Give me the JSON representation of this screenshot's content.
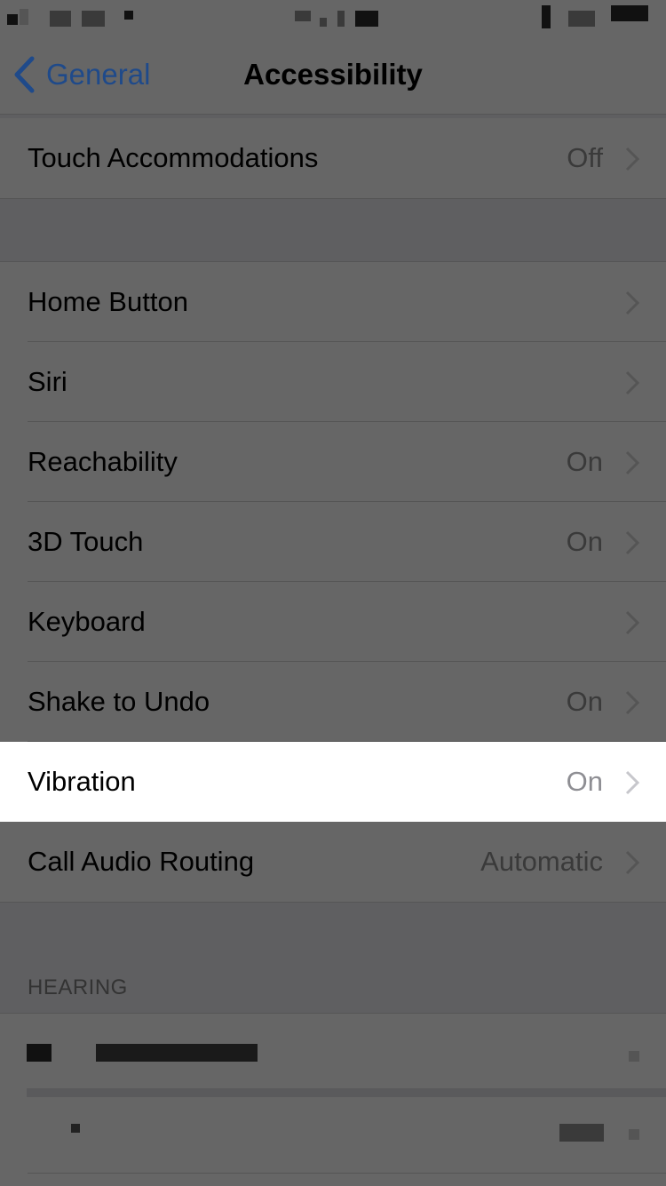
{
  "overlay_dim": true,
  "status_bar": {
    "content": "pixelated"
  },
  "navbar": {
    "back_label": "General",
    "title": "Accessibility",
    "accent_color": "#1f4a8a"
  },
  "groups": [
    {
      "rows": [
        {
          "label": "Touch Accommodations",
          "value": "Off",
          "chevron": true
        }
      ]
    },
    {
      "rows": [
        {
          "label": "Home Button",
          "value": "",
          "chevron": true
        },
        {
          "label": "Siri",
          "value": "",
          "chevron": true
        },
        {
          "label": "Reachability",
          "value": "On",
          "chevron": true
        },
        {
          "label": "3D Touch",
          "value": "On",
          "chevron": true
        },
        {
          "label": "Keyboard",
          "value": "",
          "chevron": true
        },
        {
          "label": "Shake to Undo",
          "value": "On",
          "chevron": true
        },
        {
          "label": "Vibration",
          "value": "On",
          "chevron": true,
          "highlighted": true
        },
        {
          "label": "Call Audio Routing",
          "value": "Automatic",
          "chevron": true
        }
      ]
    }
  ],
  "hearing_section": {
    "header": "HEARING",
    "rows": [
      {
        "label": "pixelated",
        "value": "pixelated"
      },
      {
        "label": "pixelated",
        "value": "pixelated"
      }
    ]
  }
}
